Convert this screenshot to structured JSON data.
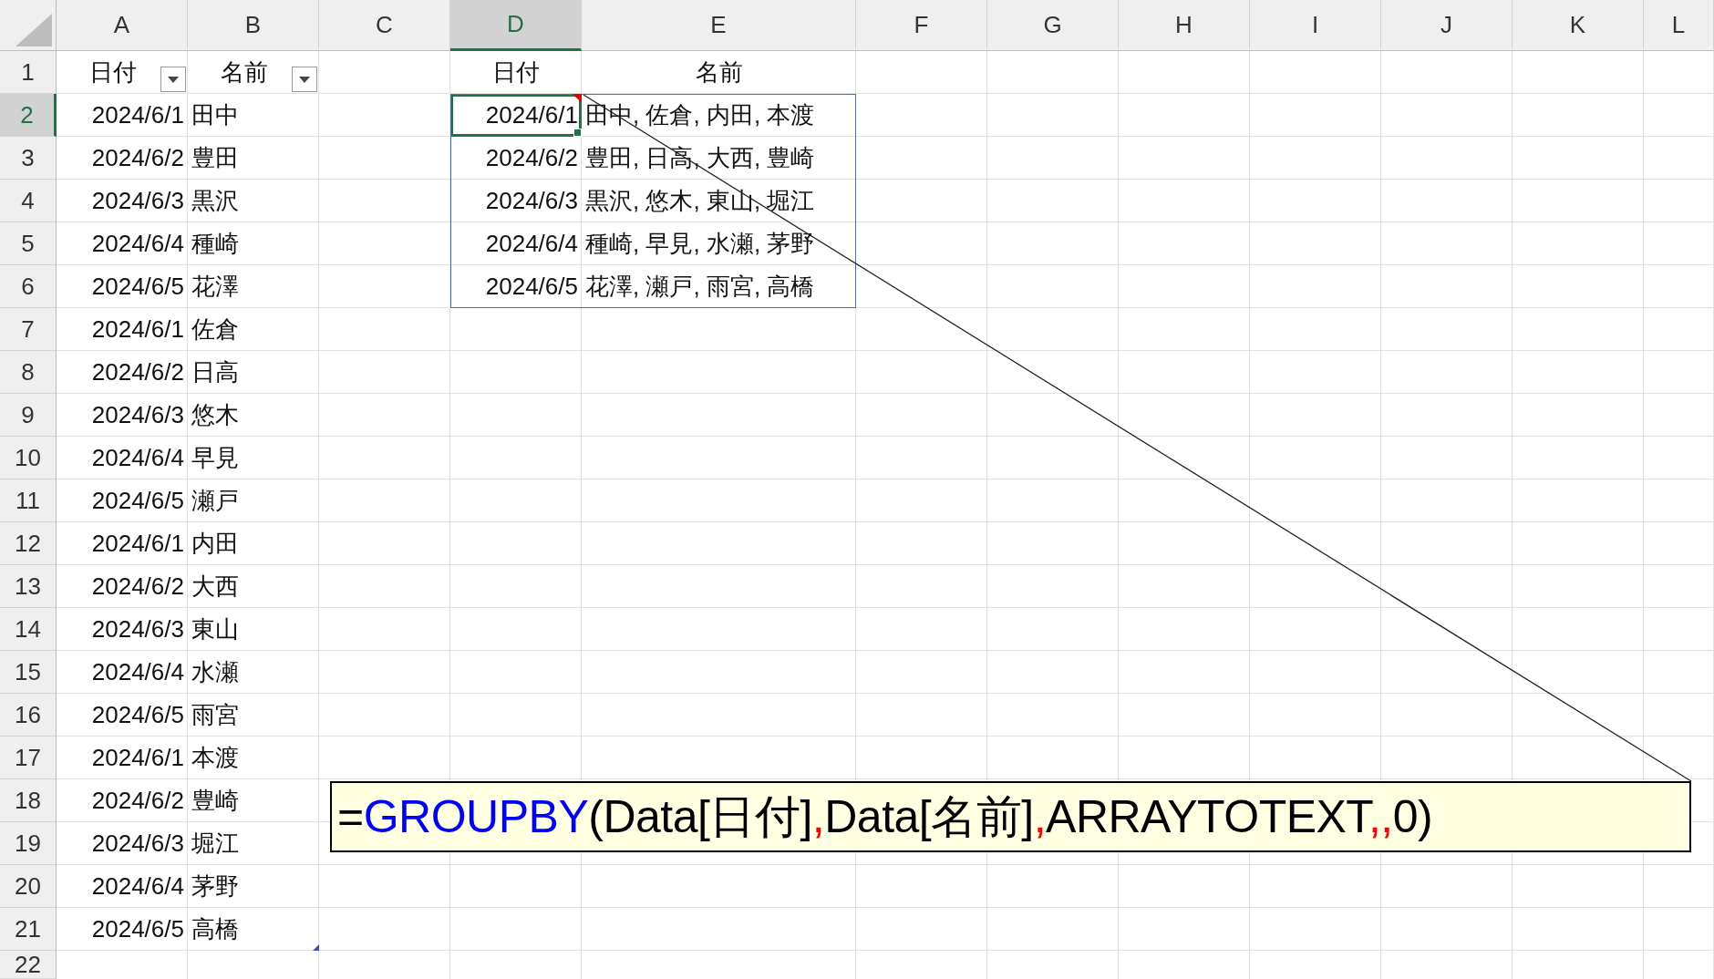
{
  "column_headers": [
    {
      "label": "A",
      "selected": false
    },
    {
      "label": "B",
      "selected": false
    },
    {
      "label": "C",
      "selected": false
    },
    {
      "label": "D",
      "selected": true
    },
    {
      "label": "E",
      "selected": false
    },
    {
      "label": "F",
      "selected": false
    },
    {
      "label": "G",
      "selected": false
    },
    {
      "label": "H",
      "selected": false
    },
    {
      "label": "I",
      "selected": false
    },
    {
      "label": "J",
      "selected": false
    },
    {
      "label": "K",
      "selected": false
    },
    {
      "label": "L",
      "selected": false
    }
  ],
  "row_headers": [
    {
      "label": "1",
      "selected": false
    },
    {
      "label": "2",
      "selected": true
    },
    {
      "label": "3",
      "selected": false
    },
    {
      "label": "4",
      "selected": false
    },
    {
      "label": "5",
      "selected": false
    },
    {
      "label": "6",
      "selected": false
    },
    {
      "label": "7",
      "selected": false
    },
    {
      "label": "8",
      "selected": false
    },
    {
      "label": "9",
      "selected": false
    },
    {
      "label": "10",
      "selected": false
    },
    {
      "label": "11",
      "selected": false
    },
    {
      "label": "12",
      "selected": false
    },
    {
      "label": "13",
      "selected": false
    },
    {
      "label": "14",
      "selected": false
    },
    {
      "label": "15",
      "selected": false
    },
    {
      "label": "16",
      "selected": false
    },
    {
      "label": "17",
      "selected": false
    },
    {
      "label": "18",
      "selected": false
    },
    {
      "label": "19",
      "selected": false
    },
    {
      "label": "20",
      "selected": false
    },
    {
      "label": "21",
      "selected": false
    },
    {
      "label": "22",
      "selected": false
    }
  ],
  "source_table": {
    "headers": [
      {
        "text": "日付",
        "filter": true
      },
      {
        "text": "名前",
        "filter": true
      }
    ],
    "rows": [
      [
        "2024/6/1",
        "田中"
      ],
      [
        "2024/6/2",
        "豊田"
      ],
      [
        "2024/6/3",
        "黒沢"
      ],
      [
        "2024/6/4",
        "種崎"
      ],
      [
        "2024/6/5",
        "花澤"
      ],
      [
        "2024/6/1",
        "佐倉"
      ],
      [
        "2024/6/2",
        "日高"
      ],
      [
        "2024/6/3",
        "悠木"
      ],
      [
        "2024/6/4",
        "早見"
      ],
      [
        "2024/6/5",
        "瀬戸"
      ],
      [
        "2024/6/1",
        "内田"
      ],
      [
        "2024/6/2",
        "大西"
      ],
      [
        "2024/6/3",
        "東山"
      ],
      [
        "2024/6/4",
        "水瀬"
      ],
      [
        "2024/6/5",
        "雨宮"
      ],
      [
        "2024/6/1",
        "本渡"
      ],
      [
        "2024/6/2",
        "豊崎"
      ],
      [
        "2024/6/3",
        "堀江"
      ],
      [
        "2024/6/4",
        "茅野"
      ],
      [
        "2024/6/5",
        "高橋"
      ]
    ]
  },
  "result": {
    "headers": [
      "日付",
      "名前"
    ],
    "note": true,
    "rows": [
      [
        "2024/6/1",
        "田中, 佐倉, 内田, 本渡"
      ],
      [
        "2024/6/2",
        "豊田, 日高, 大西, 豊崎"
      ],
      [
        "2024/6/3",
        "黒沢, 悠木, 東山, 堀江"
      ],
      [
        "2024/6/4",
        "種崎, 早見, 水瀬, 茅野"
      ],
      [
        "2024/6/5",
        "花澤, 瀬戸, 雨宮, 高橋"
      ]
    ]
  },
  "formula_note": {
    "segments": [
      {
        "text": "=",
        "kind": "plain"
      },
      {
        "text": "GROUPBY",
        "kind": "function"
      },
      {
        "text": "(Data[日付]",
        "kind": "plain"
      },
      {
        "text": ",",
        "kind": "separator"
      },
      {
        "text": "Data[名前]",
        "kind": "plain"
      },
      {
        "text": ",",
        "kind": "separator"
      },
      {
        "text": "ARRAYTOTEXT",
        "kind": "plain"
      },
      {
        "text": ",",
        "kind": "separator"
      },
      {
        "text": ",",
        "kind": "separator"
      },
      {
        "text": "0)",
        "kind": "plain"
      }
    ]
  }
}
